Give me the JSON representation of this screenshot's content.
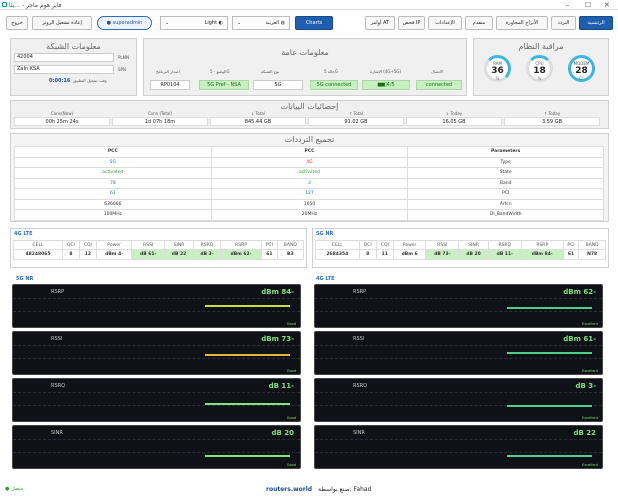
{
  "window": {
    "title": "فاير هوم ماجر - ...يثا"
  },
  "toolbar": {
    "exit": "خروج",
    "restart": "إعادة تشغيل الروتر",
    "user": "superadmin",
    "theme": "Light",
    "language": "العربية",
    "charts": "Charts",
    "at": "أوامر AT",
    "ip": "فحص IP",
    "settings": "الإعدادات",
    "advanced": "متقدم",
    "neighbors": "الأبراج المجاورة",
    "freq": "التردد",
    "home": "الرئيسية"
  },
  "network": {
    "title": "معلومات الشبكة",
    "plmn": "42004",
    "plmn_label": "PLMN",
    "spn": "ZaIn KSA",
    "spn_label": "SPN",
    "uptime_label": "وقت تشغيل التطبيق",
    "uptime": "0:00:16"
  },
  "general": {
    "title": "معلومات عامة",
    "version_label": "اصدار البرنامج",
    "version": "RP0104",
    "mode_label": "الوضع - 5G",
    "mode": "5G Pref - NSA",
    "nettype_label": "نوع الشبكة",
    "nettype": "5G",
    "state_label": "حالة 5G",
    "state": "5G connected",
    "signal_label": "الإشارة (4G+5G)",
    "signal": "4/5",
    "conn_label": "الاتصال",
    "conn": "connected"
  },
  "monitor": {
    "title": "مراقبة النظام",
    "gauges": [
      {
        "name": "MODEM",
        "value": "28",
        "unit": "C°"
      },
      {
        "name": "CPU",
        "value": "18",
        "unit": "%"
      },
      {
        "name": "RAM",
        "value": "36",
        "unit": "%"
      }
    ]
  },
  "stats": {
    "title": "إحصائيات البيانات",
    "items": [
      {
        "h": "Conn(Now)",
        "v": "00h 25m 24s"
      },
      {
        "h": "Conn (Total)",
        "v": "1d 07h 18m"
      },
      {
        "h": "↓ Total",
        "v": "845.44 GB"
      },
      {
        "h": "↑ Total",
        "v": "91.02 GB"
      },
      {
        "h": "↓ Today",
        "v": "16.05 GB"
      },
      {
        "h": "↑ Today",
        "v": "3.59 GB"
      }
    ]
  },
  "freq": {
    "title": "تجميع الترددات",
    "headers": [
      "PCC",
      "PCC",
      "Parameters"
    ],
    "rows": [
      [
        "5G",
        "4G",
        "Type"
      ],
      [
        "activated",
        "activated",
        "State"
      ],
      [
        "78",
        "3",
        "Band"
      ],
      [
        "61",
        "127",
        "PCI"
      ],
      [
        "636666",
        "1650",
        "Arfcn"
      ],
      [
        "100MHz",
        "20MHz",
        "Dl_BandWidth"
      ]
    ]
  },
  "lte_table": {
    "label": "4G LTE",
    "headers": [
      "CELL",
      "QCI",
      "CQI",
      "Power",
      "RSSI",
      "SINR",
      "RSRQ",
      "RSRP",
      "PCI",
      "BAND"
    ],
    "values": [
      "48248065",
      "8",
      "12",
      "dBm 4-",
      "dB 61-",
      "dB 22",
      "dB 3-",
      "dBm 62-",
      "61",
      "B3"
    ]
  },
  "nr_table": {
    "label": "5G NR",
    "headers": [
      "CELL",
      "QCI",
      "CQI",
      "Power",
      "RSSI",
      "SINR",
      "RSRQ",
      "RSRP",
      "PCI",
      "BAND"
    ],
    "values": [
      "2684354",
      "8",
      "11",
      "dBm 6",
      "dB 73-",
      "dB 20",
      "dB 11-",
      "dBm 84-",
      "61",
      "N78"
    ]
  },
  "charts": {
    "nr_label": "5G NR",
    "lte_label": "4G LTE",
    "nr": [
      {
        "name": "RSRP",
        "value": "dBm 84-",
        "quality": "Good",
        "level": 0.55,
        "color": "#c8e03a"
      },
      {
        "name": "RSSI",
        "value": "dBm 73-",
        "quality": "Good",
        "level": 0.5,
        "color": "#e0b83a"
      },
      {
        "name": "RSRQ",
        "value": "dB 11-",
        "quality": "Good",
        "level": 0.45,
        "color": "#7ee37e"
      },
      {
        "name": "SINR",
        "value": "dB 20",
        "quality": "Good",
        "level": 0.35,
        "color": "#7ee37e"
      }
    ],
    "lte": [
      {
        "name": "RSRP",
        "value": "dBm 62-",
        "quality": "Excellent",
        "level": 0.5,
        "color": "#4fd08a"
      },
      {
        "name": "RSSI",
        "value": "dBm 61-",
        "quality": "Excellent",
        "level": 0.55,
        "color": "#4fd08a"
      },
      {
        "name": "RSRQ",
        "value": "dB 3-",
        "quality": "Excellent",
        "level": 0.4,
        "color": "#4fd08a"
      },
      {
        "name": "SINR",
        "value": "dB 22",
        "quality": "Excellent",
        "level": 0.35,
        "color": "#4fd08a"
      }
    ]
  },
  "footer": {
    "status": "متصل",
    "site": "routers.world",
    "credit": "صنع بواسطة: Fahad"
  }
}
